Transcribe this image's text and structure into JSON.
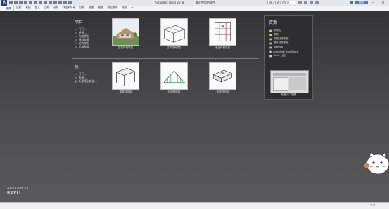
{
  "titlebar": {
    "app_title": "Autodesk Revit 2018",
    "doc_title": "最近使用的文件",
    "search_value": "键入关键字或短语",
    "login": "登录"
  },
  "ribbon": {
    "tabs": [
      "建筑",
      "结构",
      "系统",
      "插入",
      "注释",
      "分析",
      "体量和场地",
      "协作",
      "视图",
      "管理",
      "附加模块",
      "修改"
    ]
  },
  "projects": {
    "title": "项目",
    "links": [
      "打开...",
      "新建...",
      "构造样板",
      "建筑样板",
      "结构样板",
      "机械样板"
    ],
    "thumbs": [
      {
        "caption": "建筑样例项目"
      },
      {
        "caption": "结构样例项目"
      },
      {
        "caption": "系统样例项目"
      }
    ]
  },
  "families": {
    "title": "族",
    "links": [
      "打开...",
      "新建...",
      "新建概念体量..."
    ],
    "thumbs": [
      {
        "caption": "建筑样例族"
      },
      {
        "caption": "结构样例族"
      },
      {
        "caption": "系统样例族"
      }
    ]
  },
  "resources": {
    "title": "资源",
    "links": [
      "新特性",
      "帮助",
      "新增功能视频",
      "基本技能视频",
      "其他视频",
      "Autodesk App Store",
      "Revit 社区"
    ],
    "video_caption": "快速入门视频"
  },
  "logo": {
    "line1": "AUTODESK",
    "line2": "REVIT"
  },
  "status": {
    "text": "0"
  },
  "colors": {
    "accent": "#3e7dd1",
    "background": "#4a4a4c",
    "panel": "#2e2e30"
  }
}
